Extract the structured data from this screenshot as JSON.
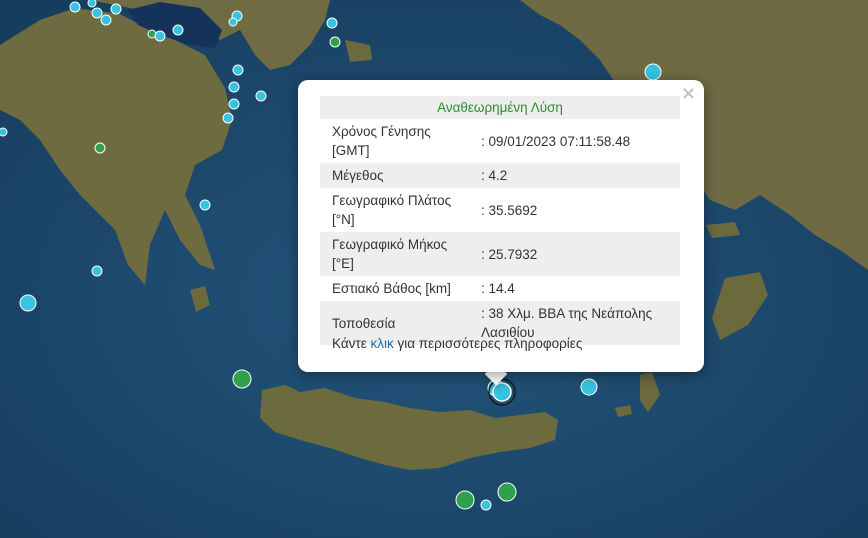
{
  "map": {
    "colors": {
      "sea": "#1d4a70",
      "land": "#6b6a3d",
      "quake_blue": "#37c3e2",
      "quake_green": "#2fa14d"
    },
    "quakes": [
      {
        "lat": 35.5692,
        "lon": 25.7932,
        "color": "blue",
        "size": 3,
        "selected": true
      }
    ]
  },
  "popup": {
    "title": "Αναθεωρημένη Λύση",
    "rows": [
      {
        "label": "Χρόνος Γένησης [GMT]",
        "value": ": 09/01/2023 07:11:58.48"
      },
      {
        "label": "Μέγεθος",
        "value": ": 4.2"
      },
      {
        "label": "Γεωγραφικό Πλάτος [°N]",
        "value": ": 35.5692"
      },
      {
        "label": "Γεωγραφικό Μήκος [°E]",
        "value": ": 25.7932"
      },
      {
        "label": "Εστιακό Βάθος [km]",
        "value": ": 14.4"
      },
      {
        "label": "Τοποθεσία",
        "value": ": 38 Χλμ. ΒΒΑ της Νεάπολης Λασιθίου"
      }
    ],
    "footer_before": "Κάντε ",
    "footer_link": "κλικ",
    "footer_after": " για περισσότερες πληροφορίες",
    "close_symbol": "×"
  }
}
